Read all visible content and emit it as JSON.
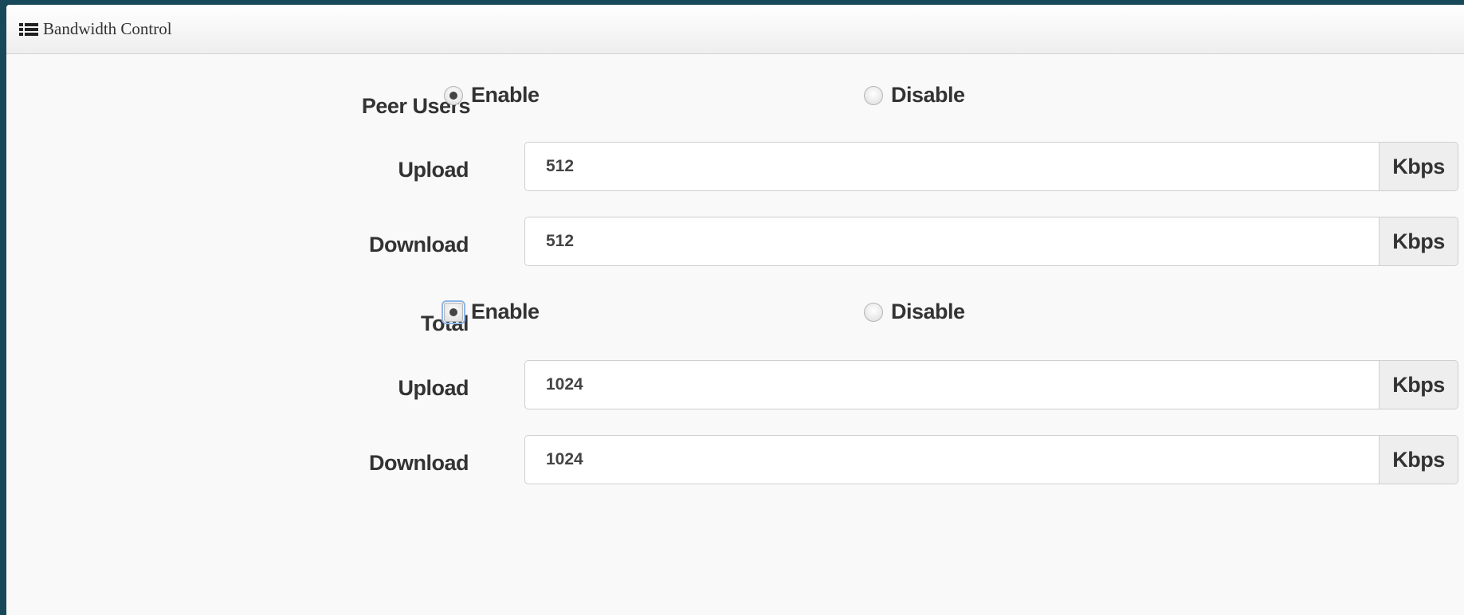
{
  "panel": {
    "title": "Bandwidth Control",
    "icon": "list-icon"
  },
  "peer_users": {
    "label": "Peer Users",
    "enable_label": "Enable",
    "disable_label": "Disable",
    "selected": "Enable",
    "upload": {
      "label": "Upload",
      "value": "512",
      "unit": "Kbps"
    },
    "download": {
      "label": "Download",
      "value": "512",
      "unit": "Kbps"
    }
  },
  "total": {
    "label": "Total",
    "enable_label": "Enable",
    "disable_label": "Disable",
    "selected": "Enable",
    "upload": {
      "label": "Upload",
      "value": "1024",
      "unit": "Kbps"
    },
    "download": {
      "label": "Download",
      "value": "1024",
      "unit": "Kbps"
    }
  }
}
